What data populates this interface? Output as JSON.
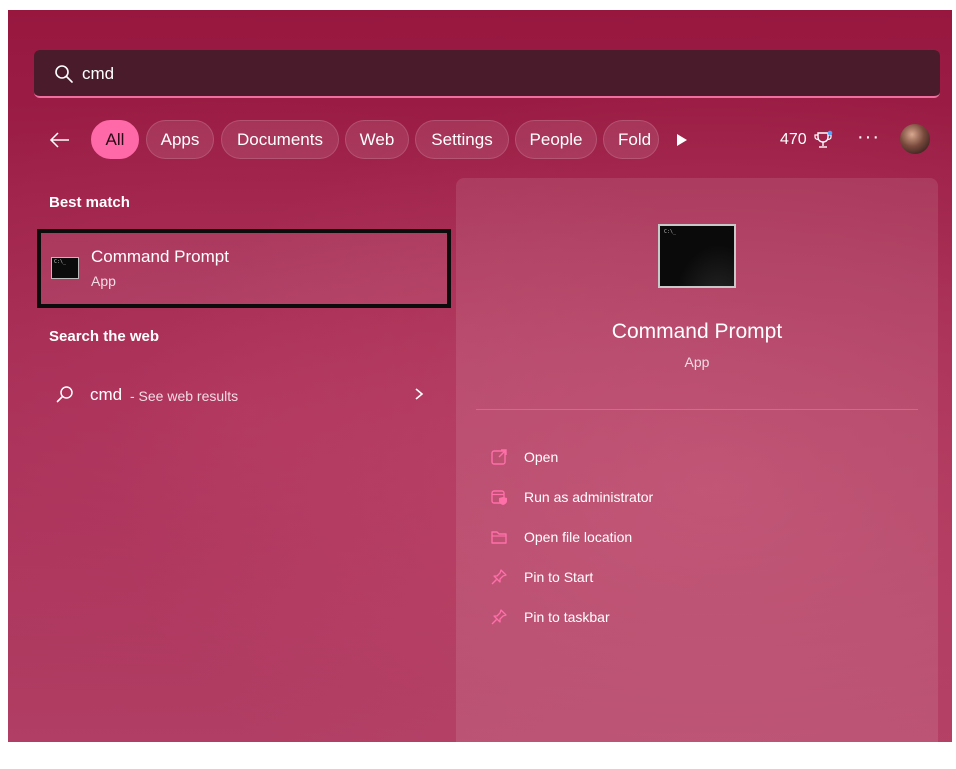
{
  "search": {
    "query": "cmd",
    "placeholder": ""
  },
  "filters": {
    "items": [
      {
        "label": "All",
        "active": true
      },
      {
        "label": "Apps"
      },
      {
        "label": "Documents"
      },
      {
        "label": "Web"
      },
      {
        "label": "Settings"
      },
      {
        "label": "People"
      },
      {
        "label": "Fold"
      }
    ],
    "points": "470"
  },
  "best_match": {
    "title": "Best match",
    "item": {
      "name": "Command Prompt",
      "type": "App",
      "icon": "command-prompt-icon",
      "icon_text": "C:\\_"
    }
  },
  "web": {
    "title": "Search the web",
    "query": "cmd",
    "suffix": "- See web results"
  },
  "preview": {
    "name": "Command Prompt",
    "type": "App",
    "icon_text": "C:\\_",
    "actions": [
      {
        "label": "Open",
        "icon": "open-external-icon"
      },
      {
        "label": "Run as administrator",
        "icon": "shield-admin-icon"
      },
      {
        "label": "Open file location",
        "icon": "folder-icon"
      },
      {
        "label": "Pin to Start",
        "icon": "pin-icon"
      },
      {
        "label": "Pin to taskbar",
        "icon": "pin-icon"
      }
    ]
  },
  "colors": {
    "accent": "#ff69a8",
    "background": "#a32a52",
    "search_bar": "#4a1c2b",
    "icon_accent": "#ff6fa8"
  }
}
